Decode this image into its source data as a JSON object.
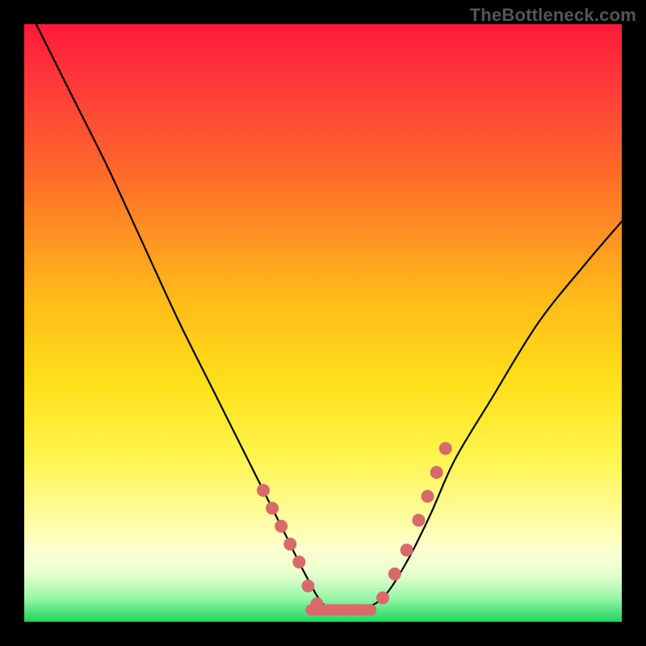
{
  "watermark": "TheBottleneck.com",
  "chart_data": {
    "type": "line",
    "title": "",
    "xlabel": "",
    "ylabel": "",
    "xlim": [
      0,
      100
    ],
    "ylim": [
      0,
      100
    ],
    "grid": false,
    "legend": false,
    "series": [
      {
        "name": "bottleneck-curve",
        "x": [
          2,
          8,
          14,
          20,
          26,
          32,
          36,
          40,
          44,
          47,
          50,
          53,
          56,
          60,
          64,
          68,
          72,
          78,
          86,
          94,
          100
        ],
        "y": [
          100,
          88,
          76,
          63,
          50,
          38,
          30,
          22,
          14,
          8,
          3,
          2,
          2,
          4,
          10,
          18,
          27,
          37,
          50,
          60,
          67
        ]
      }
    ],
    "valley_flat": {
      "x_start": 48,
      "x_end": 58,
      "y": 2
    },
    "markers_left": [
      {
        "x": 40,
        "y": 22
      },
      {
        "x": 41.5,
        "y": 19
      },
      {
        "x": 43,
        "y": 16
      },
      {
        "x": 44.5,
        "y": 13
      },
      {
        "x": 46,
        "y": 10
      },
      {
        "x": 47.5,
        "y": 6
      },
      {
        "x": 49,
        "y": 3
      }
    ],
    "markers_right": [
      {
        "x": 60,
        "y": 4
      },
      {
        "x": 62,
        "y": 8
      },
      {
        "x": 64,
        "y": 12
      },
      {
        "x": 66,
        "y": 17
      },
      {
        "x": 67.5,
        "y": 21
      },
      {
        "x": 69,
        "y": 25
      },
      {
        "x": 70.5,
        "y": 29
      }
    ],
    "colors": {
      "curve": "#000000",
      "markers": "#d86a6a",
      "gradient_top": "#ff1a3a",
      "gradient_bottom": "#1fd45a"
    }
  }
}
